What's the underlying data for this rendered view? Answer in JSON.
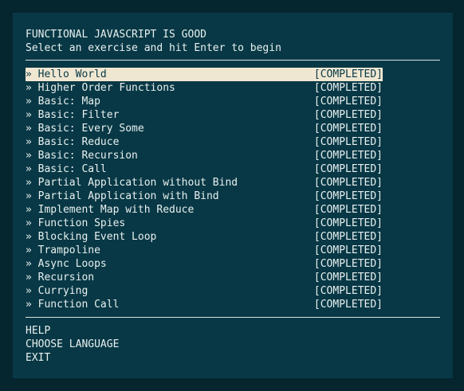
{
  "header": {
    "title": "FUNCTIONAL JAVASCRIPT IS GOOD",
    "subtitle": "Select an exercise and hit Enter to begin"
  },
  "menu": {
    "marker": "»",
    "status": "[COMPLETED]",
    "selected_index": 0,
    "items": [
      {
        "label": "Hello World"
      },
      {
        "label": "Higher Order Functions"
      },
      {
        "label": "Basic: Map"
      },
      {
        "label": "Basic: Filter"
      },
      {
        "label": "Basic: Every Some"
      },
      {
        "label": "Basic: Reduce"
      },
      {
        "label": "Basic: Recursion"
      },
      {
        "label": "Basic: Call"
      },
      {
        "label": "Partial Application without Bind"
      },
      {
        "label": "Partial Application with Bind"
      },
      {
        "label": "Implement Map with Reduce"
      },
      {
        "label": "Function Spies"
      },
      {
        "label": "Blocking Event Loop"
      },
      {
        "label": "Trampoline"
      },
      {
        "label": "Async Loops"
      },
      {
        "label": "Recursion"
      },
      {
        "label": "Currying"
      },
      {
        "label": "Function Call"
      }
    ]
  },
  "footer": {
    "help": "HELP",
    "language": "CHOOSE LANGUAGE",
    "exit": "EXIT"
  },
  "colors": {
    "background": "#05252f",
    "panel": "#083845",
    "text": "#e8f0f0",
    "selected_background": "#f0e7d2",
    "selected_text": "#083845"
  }
}
